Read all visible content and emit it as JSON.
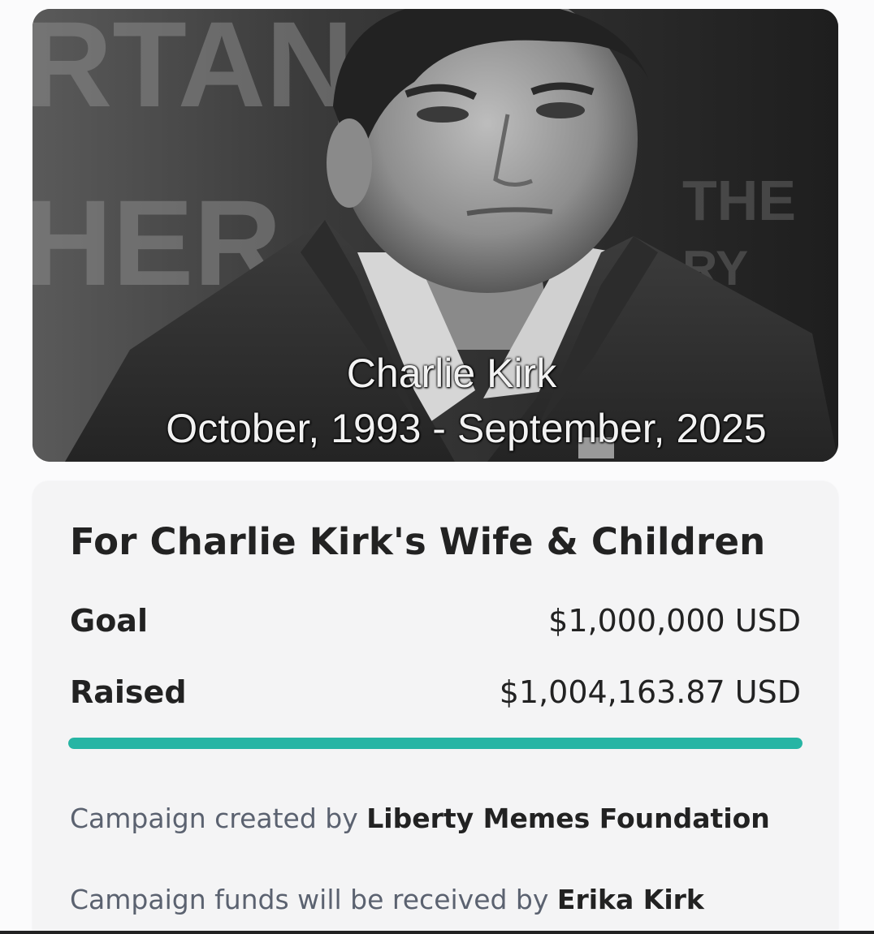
{
  "hero": {
    "caption_name": "Charlie Kirk",
    "caption_dates": "October, 1993 - September, 2025"
  },
  "campaign": {
    "title": "For Charlie Kirk's Wife & Children",
    "goal_label": "Goal",
    "goal_value": "$1,000,000 USD",
    "raised_label": "Raised",
    "raised_value": "$1,004,163.87 USD",
    "progress_fraction": 1.0,
    "creator_prefix": "Campaign created by",
    "creator_name": "Liberty Memes Foundation",
    "recipient_prefix": "Campaign funds will be received by",
    "recipient_name": "Erika Kirk"
  },
  "colors": {
    "progress_fill": "#26b5a4",
    "card_background": "#f4f4f5",
    "text_primary": "#222222",
    "text_secondary": "#5b6270"
  }
}
